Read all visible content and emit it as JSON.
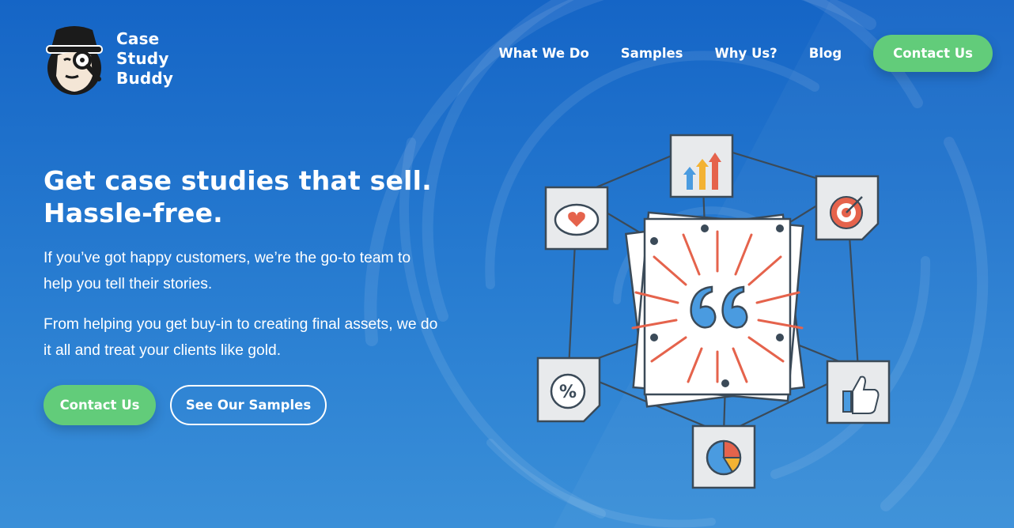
{
  "brand": {
    "line1": "Case",
    "line2": "Study",
    "line3": "Buddy"
  },
  "nav": {
    "items": [
      {
        "label": "What We Do"
      },
      {
        "label": "Samples"
      },
      {
        "label": "Why Us?"
      },
      {
        "label": "Blog"
      }
    ],
    "cta_label": "Contact Us"
  },
  "hero": {
    "headline_line1": "Get case studies that sell.",
    "headline_line2": "Hassle-free.",
    "paragraph1": "If you’ve got happy customers, we’re the go-to team to help you tell their stories.",
    "paragraph2": "From helping you get buy-in to creating final assets, we do it all and treat your clients like gold.",
    "primary_cta": "Contact Us",
    "secondary_cta": "See Our Samples"
  },
  "colors": {
    "accent_green": "#62cc7a",
    "background_blue": "#1565c6",
    "quote_blue": "#4a9be0",
    "burst_red": "#e5634c"
  },
  "illustration": {
    "icons": [
      "growth-chart-icon",
      "heart-speech-icon",
      "target-icon",
      "percent-icon",
      "thumbs-up-icon",
      "pie-chart-icon",
      "quote-icon"
    ]
  }
}
